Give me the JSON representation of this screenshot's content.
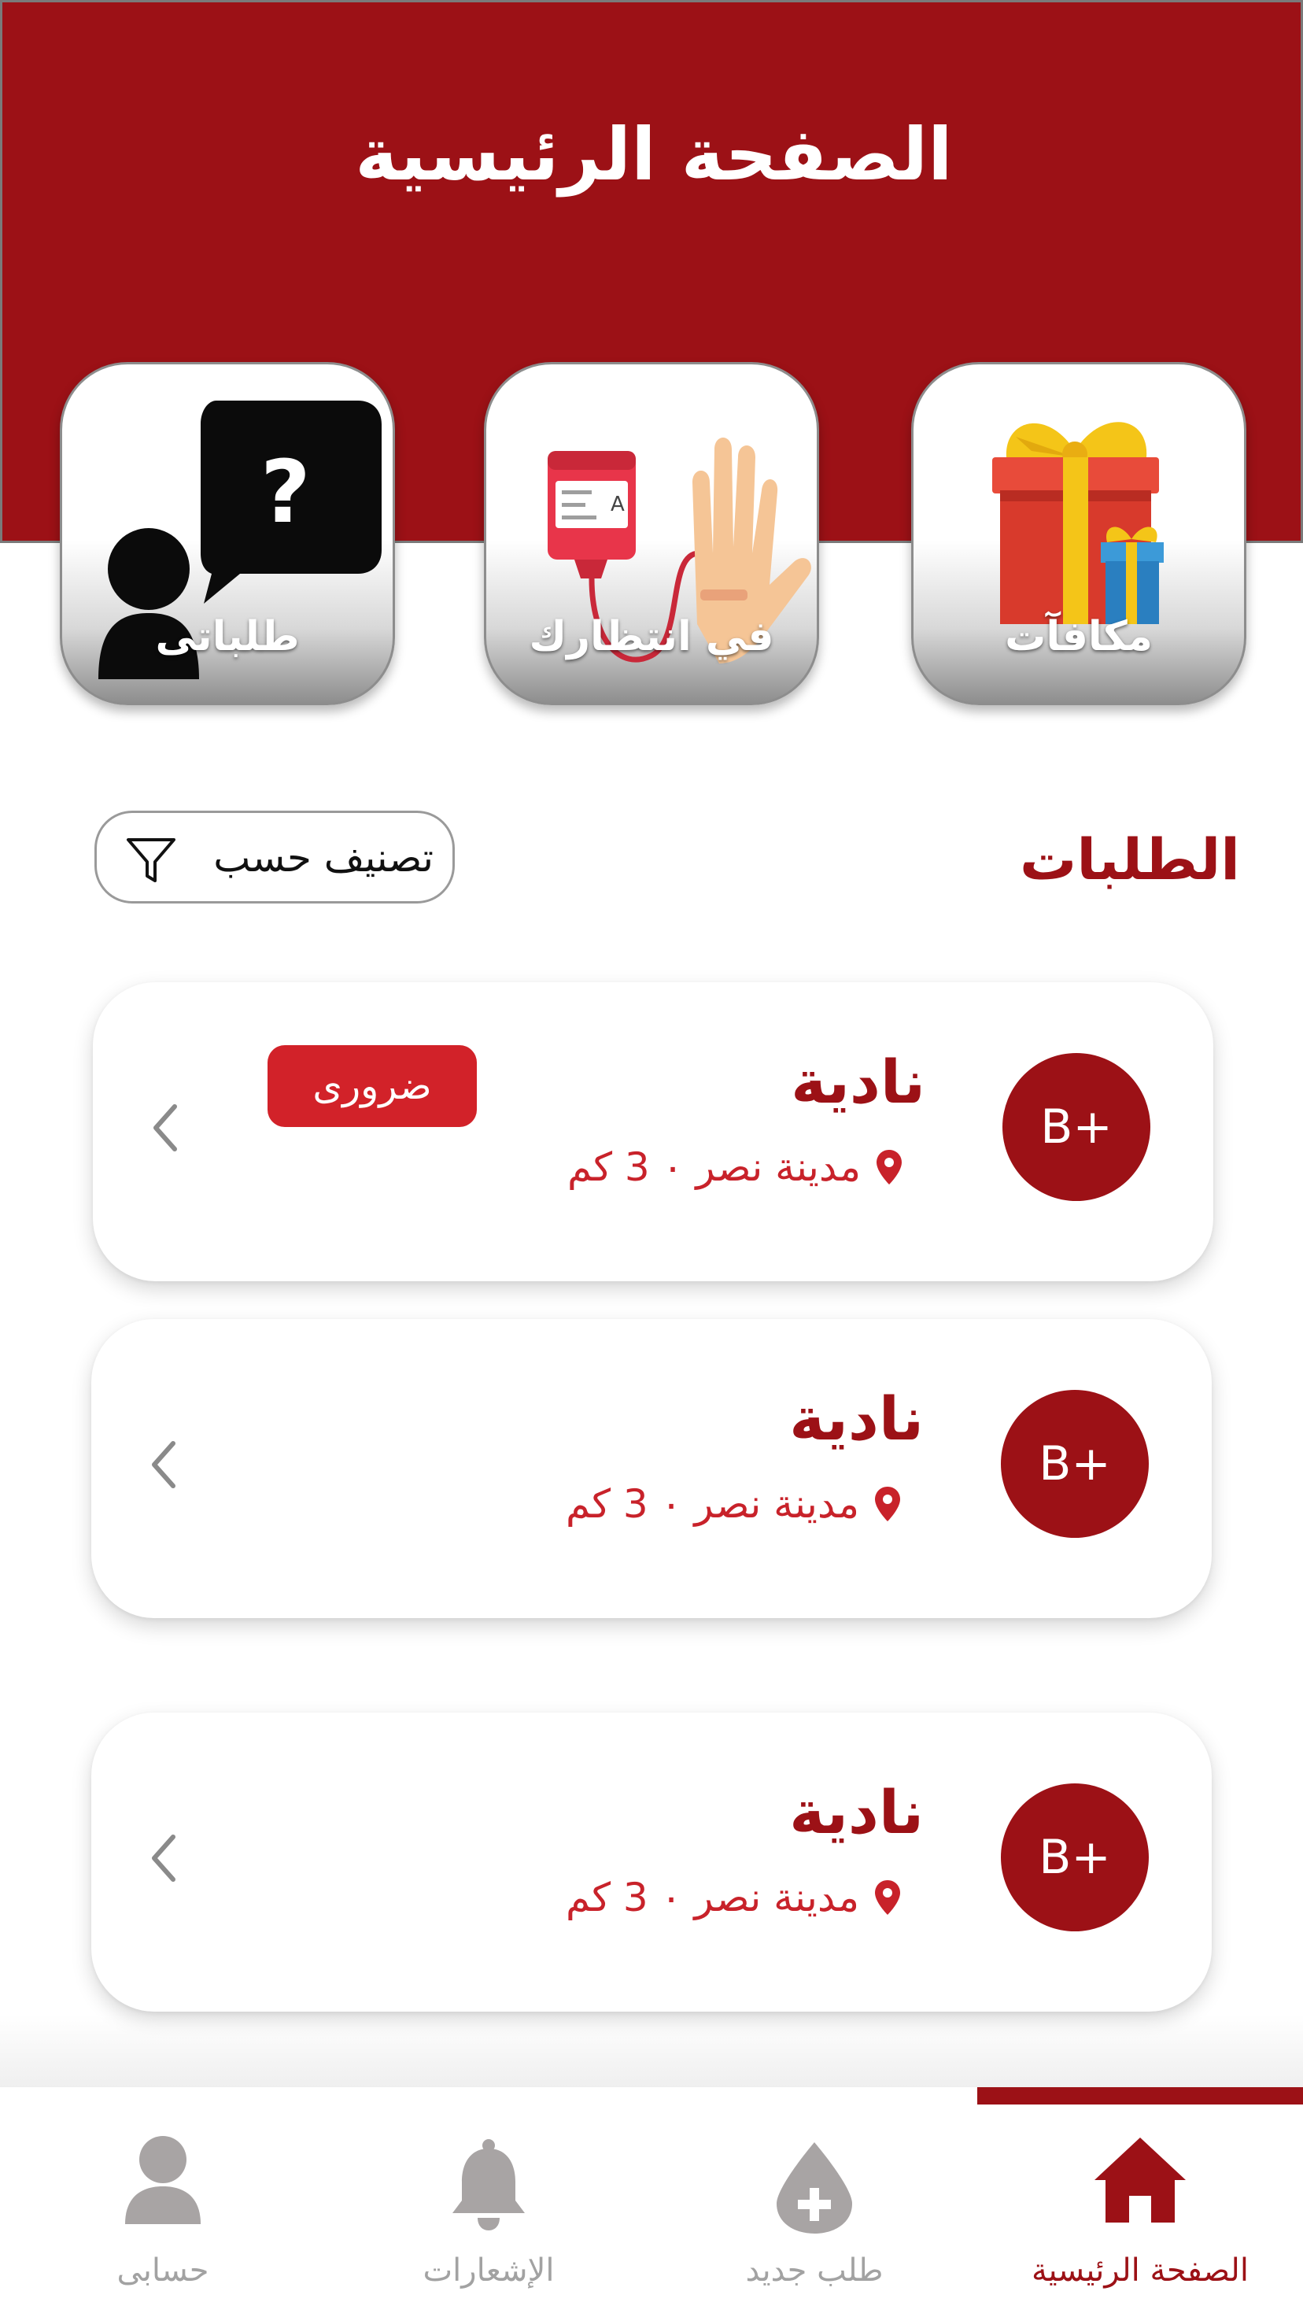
{
  "header": {
    "title": "الصفحة الرئيسية"
  },
  "tiles": [
    {
      "label": "مكافآت",
      "icon": "gift-icon"
    },
    {
      "label": "في انتظارك",
      "icon": "blood-bag-icon"
    },
    {
      "label": "طلباتى",
      "icon": "person-question-icon"
    }
  ],
  "requests_section": {
    "title": "الطلبات",
    "filter_label": "تصنيف حسب"
  },
  "requests": [
    {
      "name": "نادية",
      "blood_type": "B+",
      "location": "مدينة نصر ٠ 3 كم",
      "urgent": true,
      "urgent_label": "ضرورى"
    },
    {
      "name": "نادية",
      "blood_type": "B+",
      "location": "مدينة نصر ٠ 3 كم",
      "urgent": false
    },
    {
      "name": "نادية",
      "blood_type": "B+",
      "location": "مدينة نصر ٠ 3 كم",
      "urgent": false
    }
  ],
  "bottom_nav": {
    "items": [
      {
        "label": "الصفحة الرئيسية",
        "icon": "home-icon",
        "active": true
      },
      {
        "label": "طلب جديد",
        "icon": "blood-drop-plus-icon",
        "active": false
      },
      {
        "label": "الإشعارات",
        "icon": "bell-icon",
        "active": false
      },
      {
        "label": "حسابى",
        "icon": "user-icon",
        "active": false
      }
    ]
  },
  "colors": {
    "primary": "#9c1116",
    "urgent": "#d22229",
    "muted": "#a2a2a2"
  }
}
